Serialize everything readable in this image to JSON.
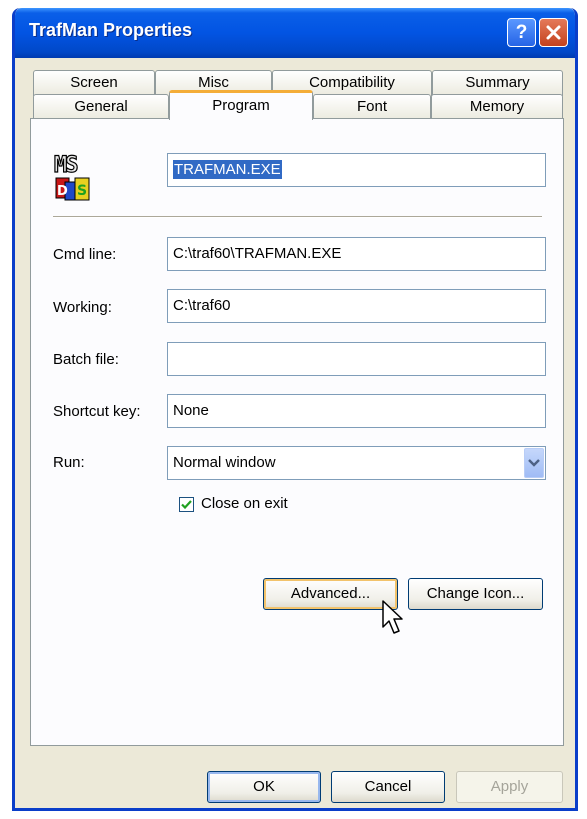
{
  "window": {
    "title": "TrafMan Properties",
    "help_glyph": "?",
    "close_glyph": "✕"
  },
  "tabs": {
    "back_row": [
      "Screen",
      "Misc",
      "Compatibility",
      "Summary"
    ],
    "front_row": [
      "General",
      "Program",
      "Font",
      "Memory"
    ],
    "active": "Program"
  },
  "program": {
    "icon": "ms-dos-icon",
    "icon_label": "MS DOS",
    "name": "TRAFMAN.EXE",
    "cmd_line_label": "Cmd line:",
    "cmd_line_value": "C:\\traf60\\TRAFMAN.EXE",
    "working_label": "Working:",
    "working_value": "C:\\traf60",
    "batch_file_label": "Batch file:",
    "batch_file_value": "",
    "shortcut_key_label": "Shortcut key:",
    "shortcut_key_value": "None",
    "run_label": "Run:",
    "run_value": "Normal window",
    "close_on_exit_label": "Close on exit",
    "close_on_exit_checked": true,
    "advanced_button": "Advanced...",
    "change_icon_button": "Change Icon..."
  },
  "footer": {
    "ok": "OK",
    "cancel": "Cancel",
    "apply": "Apply"
  },
  "colors": {
    "titlebar": "#0254e3",
    "dialog_bg": "#ece9d8",
    "active_tab_accent": "#f4ad38",
    "selection": "#316ac5"
  }
}
